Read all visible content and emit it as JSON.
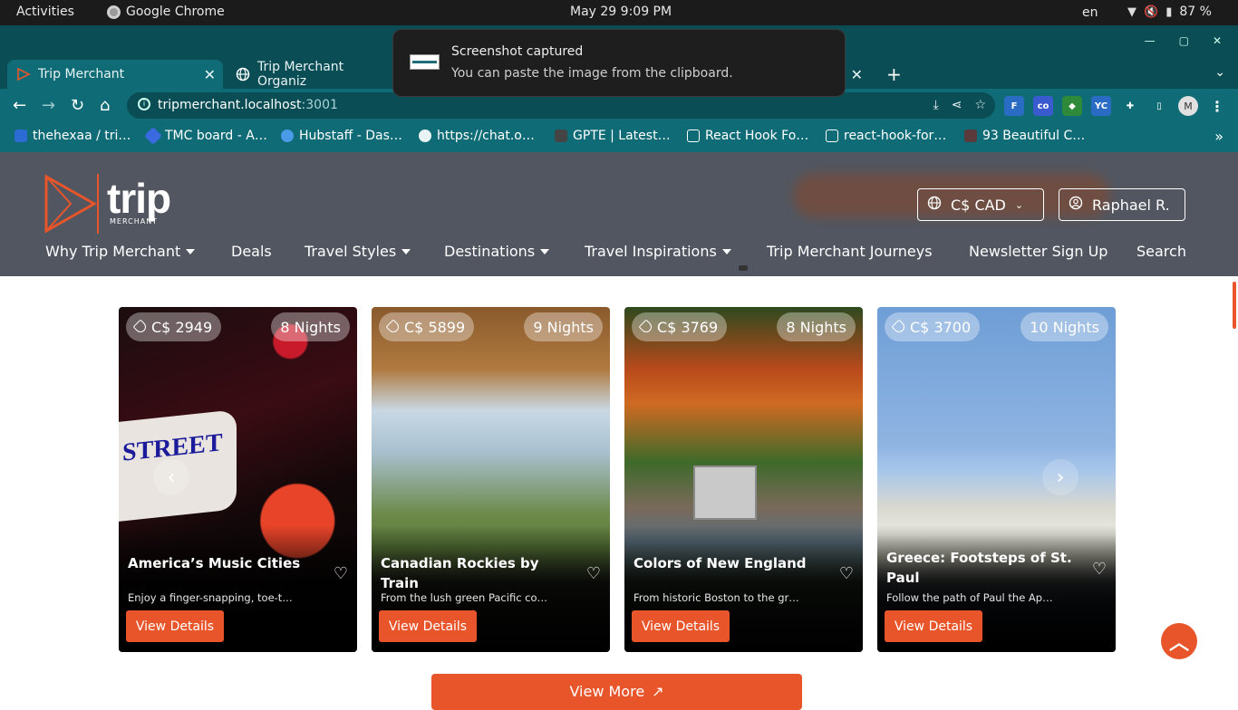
{
  "system_bar": {
    "activities": "Activities",
    "app_name": "Google Chrome",
    "datetime": "May 29  9:09 PM",
    "lang": "en",
    "battery": "87 %"
  },
  "browser": {
    "tabs": [
      {
        "title": "Trip Merchant",
        "active": true
      },
      {
        "title": "Trip Merchant Organiz",
        "active": false
      }
    ],
    "url_host": "tripmerchant.localhost",
    "url_port": ":3001",
    "profile_initial": "M",
    "extensions": [
      "F",
      "co",
      "shield",
      "YC"
    ],
    "bookmarks": [
      "thehexaa / tri…",
      "TMC board - A…",
      "Hubstaff - Das…",
      "https://chat.o…",
      "GPTE | Latest…",
      "React Hook Fo…",
      "react-hook-for…",
      "93 Beautiful C…"
    ]
  },
  "notification": {
    "title": "Screenshot captured",
    "body": "You can paste the image from the clipboard."
  },
  "site": {
    "logo_word": "trip",
    "logo_sub": "MERCHANT",
    "currency": "C$ CAD",
    "user": "Raphael R.",
    "nav": [
      {
        "label": "Why Trip Merchant",
        "dropdown": true
      },
      {
        "label": "Deals",
        "dropdown": false
      },
      {
        "label": "Travel Styles",
        "dropdown": true
      },
      {
        "label": "Destinations",
        "dropdown": true
      },
      {
        "label": "Travel Inspirations",
        "dropdown": true
      },
      {
        "label": "Trip Merchant Journeys",
        "dropdown": false
      },
      {
        "label": "Newsletter Sign Up",
        "dropdown": false
      },
      {
        "label": "Search",
        "dropdown": false
      }
    ],
    "cards": [
      {
        "price": "C$ 2949",
        "nights": "8 Nights",
        "title": "America’s Music Cities",
        "desc": "Enjoy a finger-snapping, toe-t…",
        "button": "View Details"
      },
      {
        "price": "C$ 5899",
        "nights": "9 Nights",
        "title": "Canadian Rockies by Train",
        "desc": "From the lush green Pacific co…",
        "button": "View Details"
      },
      {
        "price": "C$ 3769",
        "nights": "8 Nights",
        "title": "Colors of New England",
        "desc": "From historic Boston to the gr…",
        "button": "View Details"
      },
      {
        "price": "C$ 3700",
        "nights": "10 Nights",
        "title": "Greece: Footsteps of St. Paul",
        "desc": "Follow the path of Paul the Ap…",
        "button": "View Details"
      }
    ],
    "card1_sign_text": "STREET",
    "view_more": "View More",
    "view_more_icon": "↗"
  },
  "colors": {
    "accent": "#e8552a",
    "chrome_teal": "#0f6c77",
    "header_bg": "#515660"
  }
}
